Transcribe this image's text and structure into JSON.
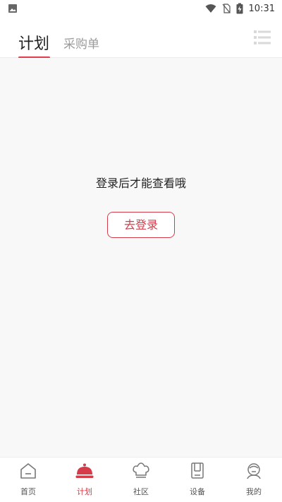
{
  "status_bar": {
    "time": "10:31",
    "icons": [
      "image-icon",
      "wifi-icon",
      "no-sim-icon",
      "battery-charging-icon"
    ]
  },
  "header": {
    "tabs": [
      {
        "label": "计划",
        "active": true
      },
      {
        "label": "采购单",
        "active": false
      }
    ],
    "menu_icon": "list-icon"
  },
  "content": {
    "message": "登录后才能查看哦",
    "login_button": "去登录"
  },
  "tabbar": {
    "items": [
      {
        "label": "首页",
        "icon": "home-icon",
        "active": false
      },
      {
        "label": "计划",
        "icon": "cloche-icon",
        "active": true
      },
      {
        "label": "社区",
        "icon": "chef-hat-icon",
        "active": false
      },
      {
        "label": "设备",
        "icon": "device-icon",
        "active": false
      },
      {
        "label": "我的",
        "icon": "profile-icon",
        "active": false
      }
    ]
  },
  "colors": {
    "accent": "#d63b4a",
    "content_bg": "#f8f8f8"
  }
}
